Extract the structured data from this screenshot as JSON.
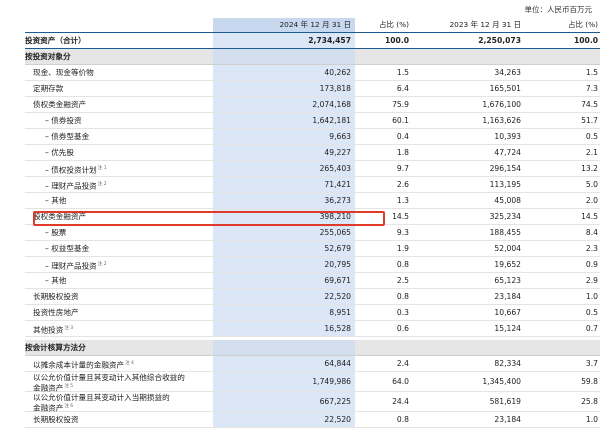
{
  "unit_note": "单位：人民币百万元",
  "header": {
    "col1": "2024 年 12 月 31 日",
    "col2": "占比 (%)",
    "col3": "2023 年 12 月 31 日",
    "col4": "占比 (%)"
  },
  "rows": [
    {
      "label": "投资资产（合计）",
      "v1": "2,734,457",
      "p1": "100.0",
      "v2": "2,250,073",
      "p2": "100.0"
    },
    {
      "label": "按投资对象分"
    },
    {
      "label": "现金、现金等价物",
      "v1": "40,262",
      "p1": "1.5",
      "v2": "34,263",
      "p2": "1.5"
    },
    {
      "label": "定期存款",
      "v1": "173,818",
      "p1": "6.4",
      "v2": "165,501",
      "p2": "7.3"
    },
    {
      "label": "债权类金融资产",
      "v1": "2,074,168",
      "p1": "75.9",
      "v2": "1,676,100",
      "p2": "74.5"
    },
    {
      "label": "– 债券投资",
      "v1": "1,642,181",
      "p1": "60.1",
      "v2": "1,163,626",
      "p2": "51.7"
    },
    {
      "label": "– 债券型基金",
      "v1": "9,663",
      "p1": "0.4",
      "v2": "10,393",
      "p2": "0.5"
    },
    {
      "label": "– 优先股",
      "v1": "49,227",
      "p1": "1.8",
      "v2": "47,724",
      "p2": "2.1"
    },
    {
      "label": "– 债权投资计划",
      "note": "注 1",
      "v1": "265,403",
      "p1": "9.7",
      "v2": "296,154",
      "p2": "13.2"
    },
    {
      "label": "– 理财产品投资",
      "note": "注 2",
      "v1": "71,421",
      "p1": "2.6",
      "v2": "113,195",
      "p2": "5.0"
    },
    {
      "label": "– 其他",
      "v1": "36,273",
      "p1": "1.3",
      "v2": "45,008",
      "p2": "2.0"
    },
    {
      "label": "股权类金融资产",
      "v1": "398,210",
      "p1": "14.5",
      "v2": "325,234",
      "p2": "14.5"
    },
    {
      "label": "– 股票",
      "v1": "255,065",
      "p1": "9.3",
      "v2": "188,455",
      "p2": "8.4"
    },
    {
      "label": "– 权益型基金",
      "v1": "52,679",
      "p1": "1.9",
      "v2": "52,004",
      "p2": "2.3"
    },
    {
      "label": "– 理财产品投资",
      "note": "注 2",
      "v1": "20,795",
      "p1": "0.8",
      "v2": "19,652",
      "p2": "0.9"
    },
    {
      "label": "– 其他",
      "v1": "69,671",
      "p1": "2.5",
      "v2": "65,123",
      "p2": "2.9"
    },
    {
      "label": "长期股权投资",
      "v1": "22,520",
      "p1": "0.8",
      "v2": "23,184",
      "p2": "1.0"
    },
    {
      "label": "投资性房地产",
      "v1": "8,951",
      "p1": "0.3",
      "v2": "10,667",
      "p2": "0.5"
    },
    {
      "label": "其他投资",
      "note": "注 3",
      "v1": "16,528",
      "p1": "0.6",
      "v2": "15,124",
      "p2": "0.7"
    },
    {
      "label": "按会计核算方法分"
    },
    {
      "label": "以摊余成本计量的金融资产",
      "note": "注 4",
      "v1": "64,844",
      "p1": "2.4",
      "v2": "82,334",
      "p2": "3.7"
    },
    {
      "label": "以公允价值计量且其变动计入其他综合收益的",
      "label2": "金融资产",
      "note": "注 5",
      "v1": "1,749,986",
      "p1": "64.0",
      "v2": "1,345,400",
      "p2": "59.8"
    },
    {
      "label": "以公允价值计量且其变动计入当期损益的",
      "label2": "金融资产",
      "note": "注 6",
      "v1": "667,225",
      "p1": "24.4",
      "v2": "581,619",
      "p2": "25.8"
    },
    {
      "label": "长期股权投资",
      "v1": "22,520",
      "p1": "0.8",
      "v2": "23,184",
      "p2": "1.0"
    }
  ]
}
